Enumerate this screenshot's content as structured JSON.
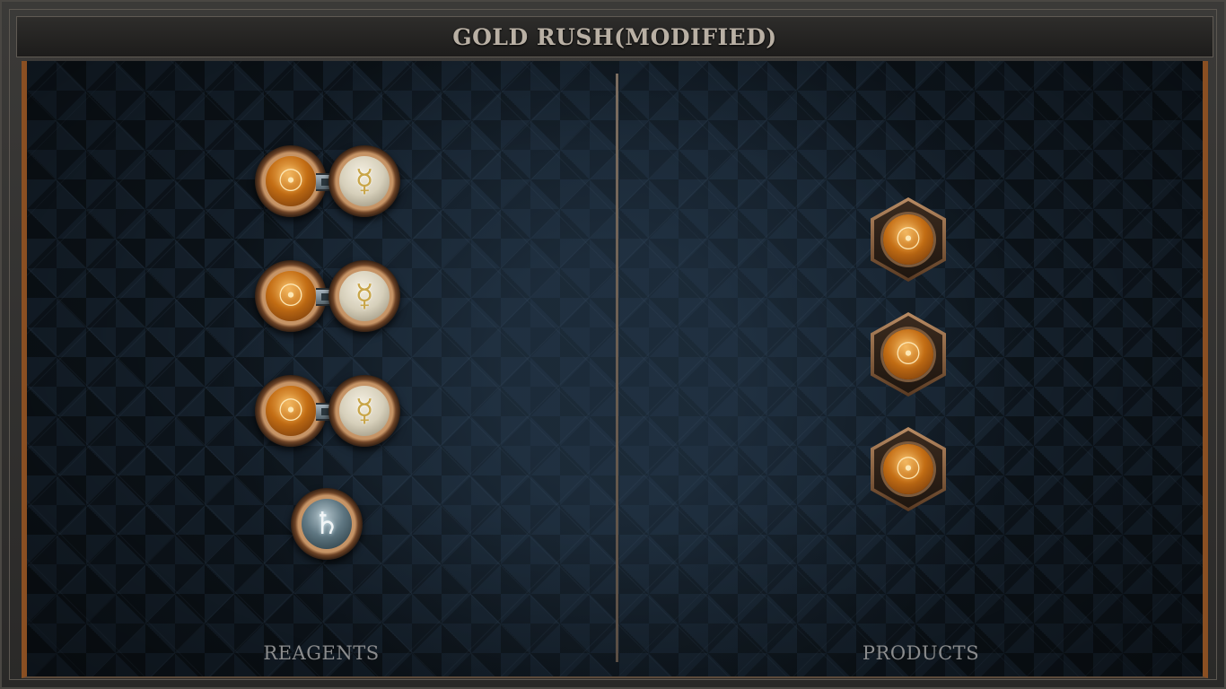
{
  "title": "GOLD RUSH(MODIFIED)",
  "columns": {
    "reagents_label": "REAGENTS",
    "products_label": "PRODUCTS"
  },
  "reagents": [
    {
      "type": "pair",
      "left": "gold",
      "right": "mercury",
      "left_symbol": "☉",
      "right_symbol": "☿"
    },
    {
      "type": "pair",
      "left": "gold",
      "right": "mercury",
      "left_symbol": "☉",
      "right_symbol": "☿"
    },
    {
      "type": "pair",
      "left": "gold",
      "right": "mercury",
      "left_symbol": "☉",
      "right_symbol": "☿"
    },
    {
      "type": "single",
      "element": "lead",
      "symbol": "♄"
    }
  ],
  "products": [
    {
      "element": "gold",
      "symbol": "☉"
    },
    {
      "element": "gold",
      "symbol": "☉"
    },
    {
      "element": "gold",
      "symbol": "☉"
    }
  ],
  "colors": {
    "board": "#16222e",
    "copper_trim": "#8a4f22",
    "title_text": "#b9b0a4",
    "label_text": "#8b8c8d"
  }
}
